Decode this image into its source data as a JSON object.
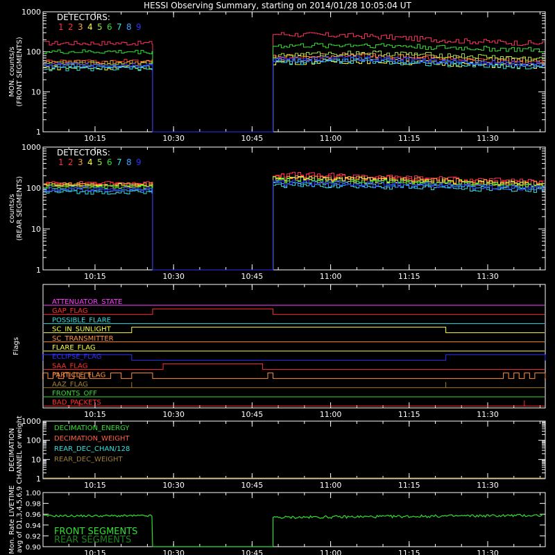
{
  "title": "HESSI Observing Summary, starting on 2014/01/28 10:05:04 UT",
  "colors": {
    "background": "#000000",
    "axis": "#ffffff",
    "detectors": [
      "#ff3060",
      "#ff3030",
      "#ffa040",
      "#ffff40",
      "#a0e040",
      "#30e030",
      "#30e0e0",
      "#40a0ff",
      "#3030ff"
    ]
  },
  "time_axis": {
    "start": "10:05:04",
    "end": "11:41:00",
    "ticks": [
      "10:15",
      "10:30",
      "10:45",
      "11:00",
      "11:15",
      "11:30"
    ]
  },
  "chart_data": [
    {
      "type": "line",
      "ylabel": "MON. counts/s\n(FRONT SEGMENTS)",
      "yscale": "log",
      "ylim": [
        1,
        1000
      ],
      "yticks": [
        "1",
        "10",
        "100",
        "1000"
      ],
      "legend_title": "DETECTORS:",
      "legend_labels": [
        "1",
        "2",
        "3",
        "4",
        "5",
        "6",
        "7",
        "8",
        "9"
      ],
      "gap": [
        "10:26",
        "10:49"
      ],
      "series": [
        {
          "name": "1",
          "before": 165,
          "after": [
            280,
            250,
            190,
            160
          ]
        },
        {
          "name": "2",
          "before": 58,
          "after": [
            70,
            78,
            65,
            55
          ]
        },
        {
          "name": "3",
          "before": 55,
          "after": [
            75,
            85,
            70,
            58
          ]
        },
        {
          "name": "4",
          "before": 40,
          "after": [
            55,
            60,
            50,
            42
          ]
        },
        {
          "name": "5",
          "before": 50,
          "after": [
            80,
            95,
            80,
            65
          ]
        },
        {
          "name": "6",
          "before": 100,
          "after": [
            140,
            150,
            125,
            110
          ]
        },
        {
          "name": "7",
          "before": 38,
          "after": [
            55,
            60,
            48,
            40
          ]
        },
        {
          "name": "8",
          "before": 45,
          "after": [
            60,
            65,
            55,
            45
          ]
        },
        {
          "name": "9",
          "before": 48,
          "after": [
            65,
            70,
            58,
            48
          ]
        }
      ],
      "gap_value": 1
    },
    {
      "type": "line",
      "ylabel": "counts/s\n(REAR SEGMENTS)",
      "yscale": "log",
      "ylim": [
        1,
        1000
      ],
      "yticks": [
        "1",
        "10",
        "100",
        "1000"
      ],
      "legend_title": "DETECTORS:",
      "legend_labels": [
        "1",
        "2",
        "3",
        "4",
        "5",
        "6",
        "7",
        "8",
        "9"
      ],
      "gap": [
        "10:26",
        "10:49"
      ],
      "series": [
        {
          "name": "1",
          "before": 130,
          "after": [
            220,
            190,
            165,
            140
          ]
        },
        {
          "name": "2",
          "before": 125,
          "after": [
            200,
            180,
            155,
            130
          ]
        },
        {
          "name": "3",
          "before": 120,
          "after": [
            185,
            170,
            150,
            125
          ]
        },
        {
          "name": "4",
          "before": 115,
          "after": [
            175,
            160,
            140,
            120
          ]
        },
        {
          "name": "5",
          "before": 110,
          "after": [
            165,
            150,
            130,
            112
          ]
        },
        {
          "name": "6",
          "before": 105,
          "after": [
            155,
            140,
            125,
            108
          ]
        },
        {
          "name": "7",
          "before": 80,
          "after": [
            120,
            112,
            100,
            90
          ]
        },
        {
          "name": "8",
          "before": 88,
          "after": [
            130,
            120,
            108,
            95
          ]
        },
        {
          "name": "9",
          "before": 95,
          "after": [
            140,
            128,
            115,
            100
          ]
        }
      ],
      "gap_value": 1
    },
    {
      "type": "line",
      "ylabel": "Flags",
      "flags": [
        {
          "name": "ATTENUATOR_STATE",
          "color": "#ff40ff",
          "transitions": []
        },
        {
          "name": "GAP_FLAG",
          "color": "#ff3030",
          "transitions": [
            [
              "10:26",
              "10:49"
            ]
          ]
        },
        {
          "name": "POSSIBLE_FLARE",
          "color": "#30e0e0",
          "transitions": []
        },
        {
          "name": "SC_IN_SUNLIGHT",
          "color": "#ffff40",
          "transitions": [
            [
              "10:22",
              "11:22"
            ]
          ]
        },
        {
          "name": "SC_TRANSMITTER",
          "color": "#ff9040",
          "transitions": []
        },
        {
          "name": "FLARE_FLAG",
          "color": "#ffff40",
          "transitions": []
        },
        {
          "name": "ECLIPSE_FLAG",
          "color": "#3030ff",
          "transitions": [
            [
              "10:05",
              "10:22"
            ],
            [
              "11:22",
              "11:41"
            ]
          ]
        },
        {
          "name": "SAA_FLAG",
          "color": "#ff3030",
          "transitions": [
            [
              "10:28",
              "10:47"
            ]
          ]
        },
        {
          "name": "PARTICLE_FLAG",
          "color": "#ff9040",
          "transitions": [
            [
              "10:05",
              "10:06"
            ],
            [
              "10:07",
              "10:08"
            ],
            [
              "10:09",
              "10:10"
            ],
            [
              "10:11",
              "10:12"
            ],
            [
              "10:13",
              "10:14"
            ],
            [
              "10:18",
              "10:20"
            ],
            [
              "10:22",
              "10:26"
            ],
            [
              "10:48",
              "10:49"
            ],
            [
              "11:33",
              "11:34"
            ],
            [
              "11:35",
              "11:36"
            ],
            [
              "11:37",
              "11:38"
            ],
            [
              "11:39",
              "11:41"
            ]
          ]
        },
        {
          "name": "AAZ_FLAG",
          "color": "#a08030",
          "transitions": [
            [
              "10:22",
              "10:22"
            ],
            [
              "11:22",
              "11:22"
            ]
          ]
        },
        {
          "name": "FRONTS_OFF",
          "color": "#30e030",
          "transitions": []
        },
        {
          "name": "BAD_PACKETS",
          "color": "#ff3030",
          "transitions": [
            [
              "10:12",
              "10:12"
            ],
            [
              "11:37",
              "11:37"
            ]
          ]
        }
      ]
    },
    {
      "type": "line",
      "ylabel": "DECIMATION\nCHANNEL or weight",
      "yscale": "log",
      "ylim": [
        1,
        1000
      ],
      "yticks": [
        "1",
        "10",
        "100",
        "1000"
      ],
      "legend": [
        {
          "label": "DECIMATION_ENERGY",
          "color": "#30e030"
        },
        {
          "label": "DECIMATION_WEIGHT",
          "color": "#ff6040"
        },
        {
          "label": "REAR_DEC_CHAN/128",
          "color": "#30e0e0"
        },
        {
          "label": "REAR_DEC_WEIGHT",
          "color": "#a08030"
        }
      ],
      "series": [
        {
          "name": "REAR_DEC_WEIGHT",
          "value": 1
        }
      ]
    },
    {
      "type": "line",
      "ylabel": "Mon. Rate LIVETIME\navg of D1,3,4,5,6,9",
      "ylim": [
        0.9,
        1.0
      ],
      "yticks": [
        "0.90",
        "0.92",
        "0.94",
        "0.96",
        "0.98",
        "1.00"
      ],
      "gap": [
        "10:26",
        "10:49"
      ],
      "gap_value": 0.9,
      "legend": [
        {
          "label": "FRONT SEGMENTS",
          "color": "#30e030"
        },
        {
          "label": "REAR SEGMENTS",
          "color": "#208020"
        }
      ],
      "series": [
        {
          "name": "FRONT SEGMENTS",
          "before": 0.957,
          "after": 0.957
        }
      ]
    }
  ]
}
